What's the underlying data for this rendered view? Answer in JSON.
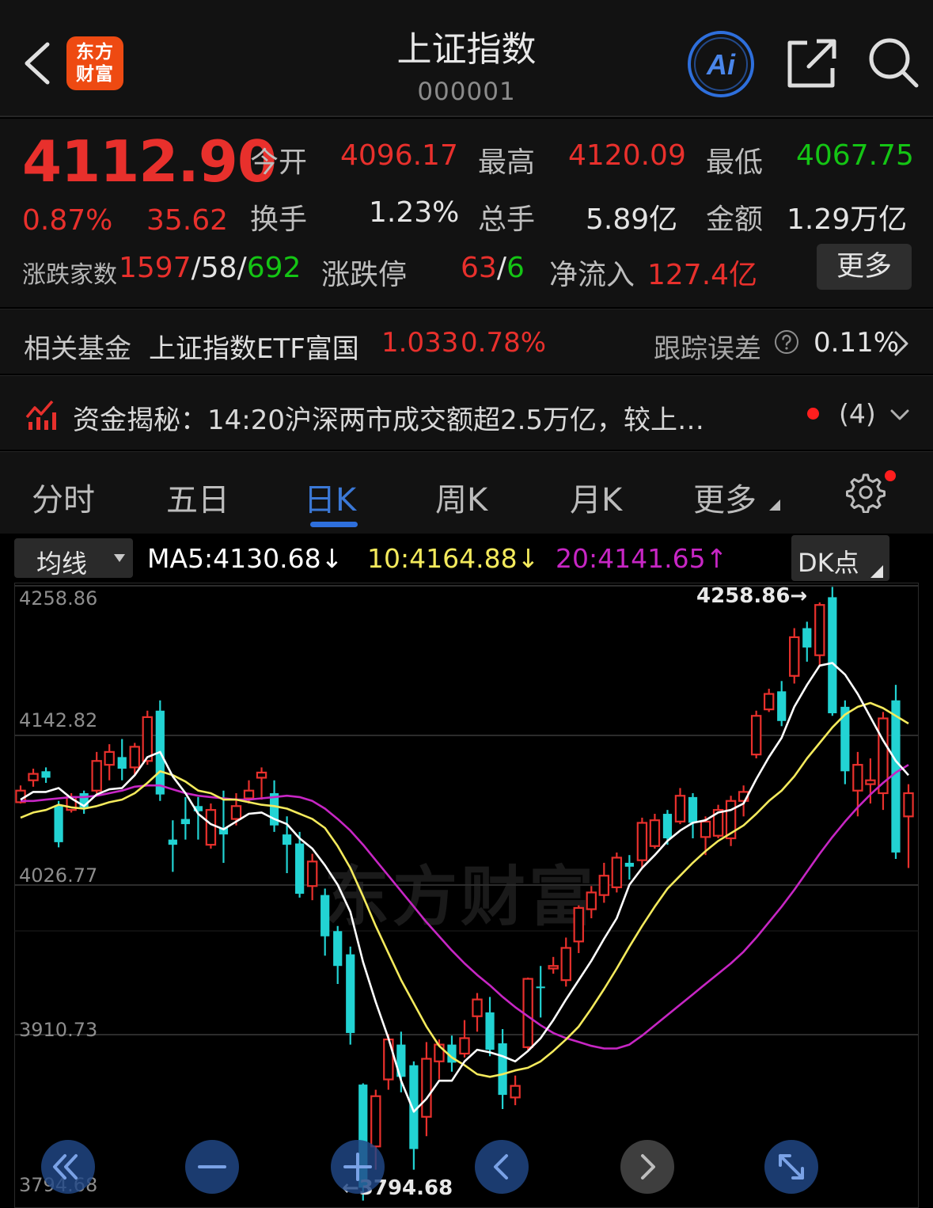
{
  "header": {
    "logo_line1": "东方",
    "logo_line2": "财富",
    "title": "上证指数",
    "code": "000001",
    "ai_label": "Ai"
  },
  "quote": {
    "price": "4112.90",
    "change_pct": "0.87%",
    "change": "35.62",
    "open_label": "今开",
    "open": "4096.17",
    "high_label": "最高",
    "high": "4120.09",
    "low_label": "最低",
    "low": "4067.75",
    "turnover_label": "换手",
    "turnover": "1.23%",
    "volume_label": "总手",
    "volume": "5.89亿",
    "amount_label": "金额",
    "amount": "1.29万亿",
    "breadth_label": "涨跌家数",
    "breadth_up": "1597",
    "breadth_flat": "58",
    "breadth_down": "692",
    "limit_label": "涨跌停",
    "limit_up": "63",
    "limit_down": "6",
    "inflow_label": "净流入",
    "inflow": "127.4亿",
    "more_label": "更多"
  },
  "fund": {
    "label": "相关基金",
    "name": "上证指数ETF富国",
    "price": "1.033",
    "pct": "0.78%",
    "error_label": "跟踪误差",
    "error_value": "0.11%"
  },
  "news": {
    "text": "资金揭秘：14:20沪深两市成交额超2.5万亿，较上…",
    "count": "(4)"
  },
  "tabs": [
    "分时",
    "五日",
    "日K",
    "周K",
    "月K",
    "更多"
  ],
  "ma_bar": {
    "select_label": "均线",
    "ma5": "MA5:4130.68↓",
    "ma10": "10:4164.88↓",
    "ma20": "20:4141.65↑",
    "dk_label": "DK点"
  },
  "colors": {
    "up": "#e8302c",
    "down": "#22d3d3",
    "ma5": "#ffffff",
    "ma10": "#f4ea5c",
    "ma20": "#c726c4",
    "accent": "#2e6fdc"
  },
  "chart_data": {
    "type": "candlestick",
    "y_ticks": [
      "4258.86",
      "4142.82",
      "4026.77",
      "3910.73",
      "3794.68"
    ],
    "ylim": [
      3794.68,
      4258.86
    ],
    "max_annotation": "4258.86→",
    "min_annotation": "←3794.68",
    "watermark": "东方财富",
    "candles": [
      {
        "o": 4091,
        "c": 4100,
        "h": 4104,
        "l": 4090
      },
      {
        "o": 4108,
        "c": 4113,
        "h": 4117,
        "l": 4103
      },
      {
        "o": 4115,
        "c": 4110,
        "h": 4118,
        "l": 4106
      },
      {
        "o": 4088,
        "c": 4060,
        "h": 4092,
        "l": 4056
      },
      {
        "o": 4085,
        "c": 4095,
        "h": 4098,
        "l": 4083
      },
      {
        "o": 4098,
        "c": 4086,
        "h": 4100,
        "l": 4082
      },
      {
        "o": 4100,
        "c": 4123,
        "h": 4130,
        "l": 4098
      },
      {
        "o": 4120,
        "c": 4130,
        "h": 4136,
        "l": 4108
      },
      {
        "o": 4126,
        "c": 4117,
        "h": 4140,
        "l": 4108
      },
      {
        "o": 4118,
        "c": 4134,
        "h": 4137,
        "l": 4112
      },
      {
        "o": 4123,
        "c": 4157,
        "h": 4162,
        "l": 4120
      },
      {
        "o": 4162,
        "c": 4097,
        "h": 4170,
        "l": 4092
      },
      {
        "o": 4062,
        "c": 4058,
        "h": 4077,
        "l": 4037
      },
      {
        "o": 4078,
        "c": 4074,
        "h": 4095,
        "l": 4062
      },
      {
        "o": 4088,
        "c": 4084,
        "h": 4095,
        "l": 4062
      },
      {
        "o": 4058,
        "c": 4085,
        "h": 4090,
        "l": 4055
      },
      {
        "o": 4071,
        "c": 4066,
        "h": 4100,
        "l": 4044
      },
      {
        "o": 4078,
        "c": 4088,
        "h": 4098,
        "l": 4073
      },
      {
        "o": 4094,
        "c": 4100,
        "h": 4108,
        "l": 4090
      },
      {
        "o": 4110,
        "c": 4114,
        "h": 4118,
        "l": 4093
      },
      {
        "o": 4098,
        "c": 4073,
        "h": 4108,
        "l": 4068
      },
      {
        "o": 4066,
        "c": 4058,
        "h": 4080,
        "l": 4036
      },
      {
        "o": 4059,
        "c": 4020,
        "h": 4068,
        "l": 4017
      },
      {
        "o": 4026,
        "c": 4045,
        "h": 4051,
        "l": 4015
      },
      {
        "o": 4019,
        "c": 3987,
        "h": 4024,
        "l": 3972
      },
      {
        "o": 3991,
        "c": 3964,
        "h": 3995,
        "l": 3950
      },
      {
        "o": 3973,
        "c": 3912,
        "h": 3979,
        "l": 3903
      },
      {
        "o": 3872,
        "c": 3792,
        "h": 3873,
        "l": 3782
      },
      {
        "o": 3824,
        "c": 3863,
        "h": 3868,
        "l": 3806
      },
      {
        "o": 3876,
        "c": 3907,
        "h": 3911,
        "l": 3868
      },
      {
        "o": 3903,
        "c": 3878,
        "h": 3913,
        "l": 3866
      },
      {
        "o": 3887,
        "c": 3822,
        "h": 3890,
        "l": 3806
      },
      {
        "o": 3847,
        "c": 3892,
        "h": 3905,
        "l": 3832
      },
      {
        "o": 3890,
        "c": 3903,
        "h": 3907,
        "l": 3876
      },
      {
        "o": 3903,
        "c": 3889,
        "h": 3910,
        "l": 3882
      },
      {
        "o": 3896,
        "c": 3908,
        "h": 3922,
        "l": 3893
      },
      {
        "o": 3925,
        "c": 3938,
        "h": 3943,
        "l": 3913
      },
      {
        "o": 3928,
        "c": 3899,
        "h": 3940,
        "l": 3894
      },
      {
        "o": 3904,
        "c": 3864,
        "h": 3915,
        "l": 3853
      },
      {
        "o": 3862,
        "c": 3871,
        "h": 3879,
        "l": 3856
      },
      {
        "o": 3901,
        "c": 3954,
        "h": 3955,
        "l": 3899
      },
      {
        "o": 3948,
        "c": 3947,
        "h": 3964,
        "l": 3924
      },
      {
        "o": 3962,
        "c": 3964,
        "h": 3971,
        "l": 3958
      },
      {
        "o": 3953,
        "c": 3978,
        "h": 3986,
        "l": 3948
      },
      {
        "o": 3983,
        "c": 4009,
        "h": 4011,
        "l": 3974
      },
      {
        "o": 4008,
        "c": 4021,
        "h": 4026,
        "l": 4001
      },
      {
        "o": 4019,
        "c": 4034,
        "h": 4044,
        "l": 4013
      },
      {
        "o": 4025,
        "c": 4048,
        "h": 4052,
        "l": 4021
      },
      {
        "o": 4044,
        "c": 4041,
        "h": 4050,
        "l": 4031
      },
      {
        "o": 4046,
        "c": 4075,
        "h": 4079,
        "l": 4040
      },
      {
        "o": 4057,
        "c": 4077,
        "h": 4082,
        "l": 4055
      },
      {
        "o": 4082,
        "c": 4063,
        "h": 4085,
        "l": 4058
      },
      {
        "o": 4076,
        "c": 4096,
        "h": 4102,
        "l": 4074
      },
      {
        "o": 4095,
        "c": 4075,
        "h": 4098,
        "l": 4063
      },
      {
        "o": 4064,
        "c": 4076,
        "h": 4080,
        "l": 4050
      },
      {
        "o": 4065,
        "c": 4085,
        "h": 4089,
        "l": 4063
      },
      {
        "o": 4063,
        "c": 4092,
        "h": 4096,
        "l": 4057
      },
      {
        "o": 4092,
        "c": 4099,
        "h": 4104,
        "l": 4080
      },
      {
        "o": 4128,
        "c": 4158,
        "h": 4162,
        "l": 4125
      },
      {
        "o": 4163,
        "c": 4175,
        "h": 4179,
        "l": 4161
      },
      {
        "o": 4177,
        "c": 4154,
        "h": 4185,
        "l": 4150
      },
      {
        "o": 4189,
        "c": 4219,
        "h": 4226,
        "l": 4183
      },
      {
        "o": 4226,
        "c": 4211,
        "h": 4231,
        "l": 4200
      },
      {
        "o": 4205,
        "c": 4244,
        "h": 4246,
        "l": 4197
      },
      {
        "o": 4250,
        "c": 4160,
        "h": 4258,
        "l": 4158
      },
      {
        "o": 4165,
        "c": 4115,
        "h": 4170,
        "l": 4105
      },
      {
        "o": 4100,
        "c": 4120,
        "h": 4130,
        "l": 4080
      },
      {
        "o": 4105,
        "c": 4108,
        "h": 4125,
        "l": 4090
      },
      {
        "o": 4098,
        "c": 4156,
        "h": 4161,
        "l": 4085
      },
      {
        "o": 4170,
        "c": 4052,
        "h": 4182,
        "l": 4047
      },
      {
        "o": 4080,
        "c": 4098,
        "h": 4105,
        "l": 4040
      }
    ],
    "ma5": [
      4093,
      4099,
      4099,
      4102,
      4094,
      4088,
      4097,
      4101,
      4102,
      4112,
      4126,
      4130,
      4111,
      4098,
      4082,
      4074,
      4070,
      4076,
      4082,
      4083,
      4078,
      4074,
      4063,
      4055,
      4042,
      4027,
      4006,
      3967,
      3936,
      3908,
      3875,
      3851,
      3861,
      3875,
      3875,
      3890,
      3899,
      3897,
      3894,
      3890,
      3898,
      3908,
      3922,
      3938,
      3953,
      3968,
      3985,
      4001,
      4027,
      4040,
      4050,
      4061,
      4069,
      4075,
      4077,
      4083,
      4085,
      4090,
      4109,
      4126,
      4141,
      4165,
      4182,
      4197,
      4199,
      4190,
      4175,
      4157,
      4139,
      4123,
      4112
    ],
    "ma10": [
      4079,
      4083,
      4085,
      4089,
      4087,
      4086,
      4088,
      4091,
      4093,
      4098,
      4106,
      4115,
      4112,
      4107,
      4100,
      4098,
      4093,
      4093,
      4091,
      4089,
      4088,
      4086,
      4082,
      4078,
      4071,
      4057,
      4040,
      4018,
      3995,
      3974,
      3953,
      3935,
      3917,
      3902,
      3893,
      3887,
      3880,
      3878,
      3880,
      3883,
      3885,
      3890,
      3898,
      3907,
      3917,
      3931,
      3946,
      3962,
      3979,
      3995,
      4010,
      4024,
      4034,
      4044,
      4053,
      4061,
      4067,
      4073,
      4082,
      4092,
      4100,
      4111,
      4125,
      4137,
      4149,
      4159,
      4165,
      4168,
      4164,
      4158,
      4152
    ],
    "ma20": [
      4092,
      4092,
      4093,
      4094,
      4095,
      4095,
      4096,
      4098,
      4100,
      4103,
      4104,
      4104,
      4101,
      4098,
      4096,
      4095,
      4094,
      4093,
      4093,
      4094,
      4095,
      4096,
      4095,
      4092,
      4086,
      4078,
      4069,
      4058,
      4046,
      4034,
      4022,
      4010,
      3998,
      3987,
      3976,
      3966,
      3957,
      3949,
      3940,
      3932,
      3925,
      3918,
      3912,
      3908,
      3905,
      3902,
      3900,
      3900,
      3903,
      3910,
      3918,
      3926,
      3934,
      3942,
      3950,
      3958,
      3966,
      3975,
      3986,
      3998,
      4010,
      4023,
      4037,
      4051,
      4064,
      4076,
      4087,
      4097,
      4106,
      4114,
      4120
    ]
  },
  "controls": [
    "fast-back",
    "zoom-out",
    "zoom-in",
    "prev",
    "next",
    "fullscreen"
  ]
}
